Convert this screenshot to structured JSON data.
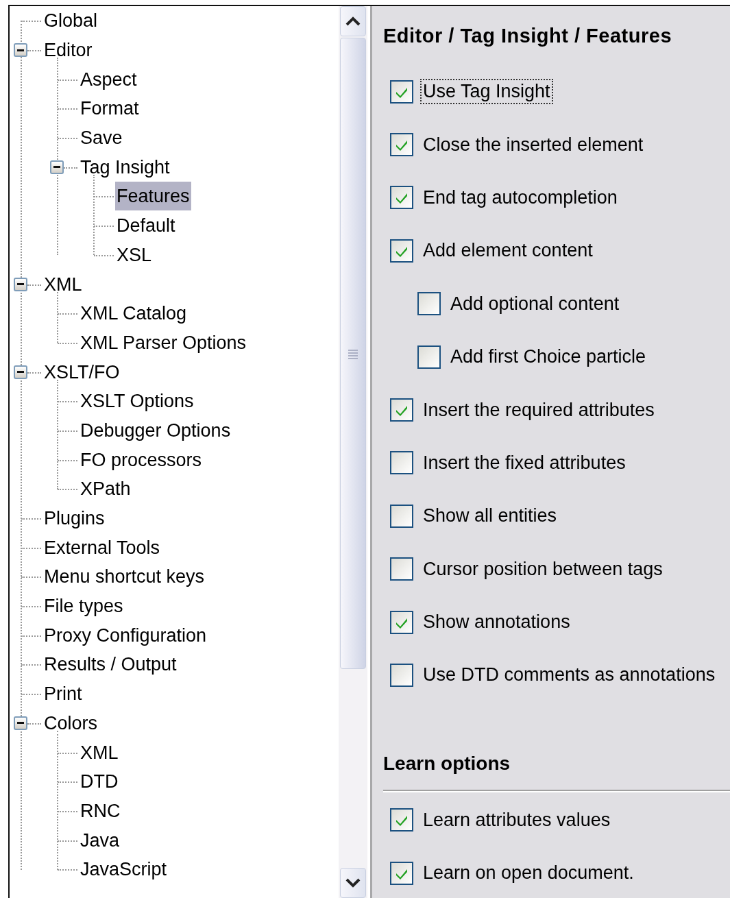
{
  "tree": {
    "items": [
      {
        "label": "Global",
        "selected": false
      },
      {
        "label": "Editor",
        "selected": false,
        "expanded": true,
        "children": [
          {
            "label": "Aspect",
            "selected": false
          },
          {
            "label": "Format",
            "selected": false
          },
          {
            "label": "Save",
            "selected": false
          },
          {
            "label": "Tag Insight",
            "selected": false,
            "expanded": true,
            "children": [
              {
                "label": "Features",
                "selected": true
              },
              {
                "label": "Default",
                "selected": false
              },
              {
                "label": "XSL",
                "selected": false
              }
            ]
          }
        ]
      },
      {
        "label": "XML",
        "selected": false,
        "expanded": true,
        "children": [
          {
            "label": "XML Catalog",
            "selected": false
          },
          {
            "label": "XML Parser Options",
            "selected": false
          }
        ]
      },
      {
        "label": "XSLT/FO",
        "selected": false,
        "expanded": true,
        "children": [
          {
            "label": "XSLT Options",
            "selected": false
          },
          {
            "label": "Debugger Options",
            "selected": false
          },
          {
            "label": "FO processors",
            "selected": false
          },
          {
            "label": "XPath",
            "selected": false
          }
        ]
      },
      {
        "label": "Plugins",
        "selected": false
      },
      {
        "label": "External Tools",
        "selected": false
      },
      {
        "label": "Menu shortcut keys",
        "selected": false
      },
      {
        "label": "File types",
        "selected": false
      },
      {
        "label": "Proxy Configuration",
        "selected": false
      },
      {
        "label": "Results / Output",
        "selected": false
      },
      {
        "label": "Print",
        "selected": false
      },
      {
        "label": "Colors",
        "selected": false,
        "expanded": true,
        "children": [
          {
            "label": "XML",
            "selected": false
          },
          {
            "label": "DTD",
            "selected": false
          },
          {
            "label": "RNC",
            "selected": false
          },
          {
            "label": "Java",
            "selected": false
          },
          {
            "label": "JavaScript",
            "selected": false
          }
        ]
      }
    ]
  },
  "panel": {
    "title": "Editor / Tag Insight / Features",
    "options": [
      {
        "label": "Use  Tag Insight",
        "checked": true,
        "focused": true
      },
      {
        "label": "Close the inserted element",
        "checked": true,
        "focused": false
      },
      {
        "label": "End tag autocompletion",
        "checked": true,
        "focused": false
      },
      {
        "label": "Add element content",
        "checked": true,
        "focused": false,
        "children": [
          {
            "label": "Add optional content",
            "checked": false,
            "focused": false
          },
          {
            "label": "Add first Choice particle",
            "checked": false,
            "focused": false
          }
        ]
      },
      {
        "label": "Insert the required attributes",
        "checked": true,
        "focused": false
      },
      {
        "label": "Insert the fixed attributes",
        "checked": false,
        "focused": false
      },
      {
        "label": "Show all entities",
        "checked": false,
        "focused": false
      },
      {
        "label": "Cursor position between tags",
        "checked": false,
        "focused": false
      },
      {
        "label": "Show annotations",
        "checked": true,
        "focused": false
      },
      {
        "label": "Use DTD comments as annotations",
        "checked": false,
        "focused": false
      }
    ],
    "learn": {
      "title": "Learn options",
      "options": [
        {
          "label": "Learn attributes values",
          "checked": true,
          "focused": false
        },
        {
          "label": "Learn on open document.",
          "checked": true,
          "focused": false
        }
      ]
    }
  }
}
